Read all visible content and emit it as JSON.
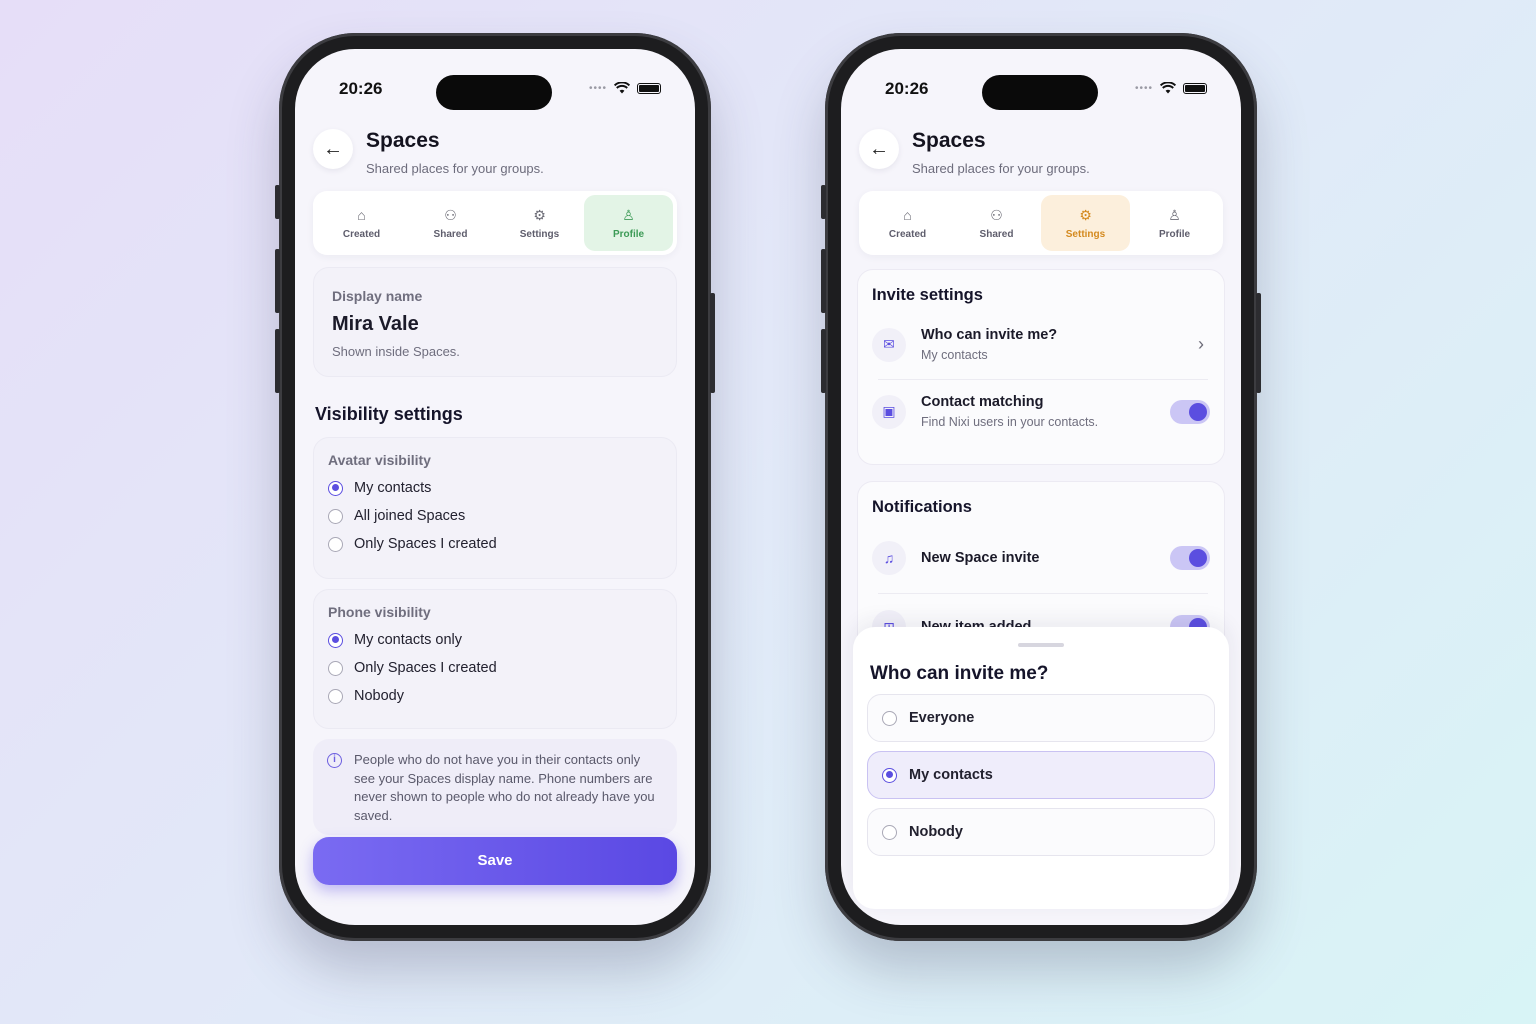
{
  "left": {
    "status_time": "20:26",
    "header": {
      "title": "Spaces",
      "subtitle": "Shared places for your groups."
    },
    "tabs": [
      {
        "label": "Created",
        "icon": "home-icon"
      },
      {
        "label": "Shared",
        "icon": "group-icon"
      },
      {
        "label": "Settings",
        "icon": "gear-icon"
      },
      {
        "label": "Profile",
        "icon": "person-icon",
        "active": true
      }
    ],
    "display_name": {
      "label": "Display name",
      "value": "Mira Vale",
      "hint": "Shown inside Spaces."
    },
    "visibility_heading": "Visibility settings",
    "avatar_visibility": {
      "label": "Avatar visibility",
      "options": [
        {
          "label": "My contacts",
          "selected": true
        },
        {
          "label": "All joined Spaces",
          "selected": false
        },
        {
          "label": "Only Spaces I created",
          "selected": false
        }
      ]
    },
    "phone_visibility": {
      "label": "Phone visibility",
      "options": [
        {
          "label": "My contacts only",
          "selected": true
        },
        {
          "label": "Only Spaces I created",
          "selected": false
        },
        {
          "label": "Nobody",
          "selected": false
        }
      ]
    },
    "info_text": "People who do not have you in their contacts only see your Spaces display name. Phone numbers are never shown to people who do not already have you saved.",
    "save_label": "Save"
  },
  "right": {
    "status_time": "20:26",
    "header": {
      "title": "Spaces",
      "subtitle": "Shared places for your groups."
    },
    "tabs": [
      {
        "label": "Created",
        "icon": "home-icon"
      },
      {
        "label": "Shared",
        "icon": "group-icon"
      },
      {
        "label": "Settings",
        "icon": "gear-icon",
        "active": true
      },
      {
        "label": "Profile",
        "icon": "person-icon"
      }
    ],
    "invite_settings": {
      "heading": "Invite settings",
      "who_can_invite": {
        "title": "Who can invite me?",
        "value": "My contacts"
      },
      "contact_matching": {
        "title": "Contact matching",
        "subtitle": "Find Nixi users in your contacts.",
        "enabled": true
      }
    },
    "notifications": {
      "heading": "Notifications",
      "items": [
        {
          "title": "New Space invite",
          "enabled": true
        },
        {
          "title": "New item added",
          "enabled": true
        }
      ]
    },
    "sheet": {
      "title": "Who can invite me?",
      "options": [
        {
          "label": "Everyone",
          "selected": false
        },
        {
          "label": "My contacts",
          "selected": true
        },
        {
          "label": "Nobody",
          "selected": false
        }
      ]
    }
  },
  "colors": {
    "accent": "#5b4ee0",
    "profile_tab": "#3c9a56",
    "settings_tab": "#d48a1f"
  }
}
